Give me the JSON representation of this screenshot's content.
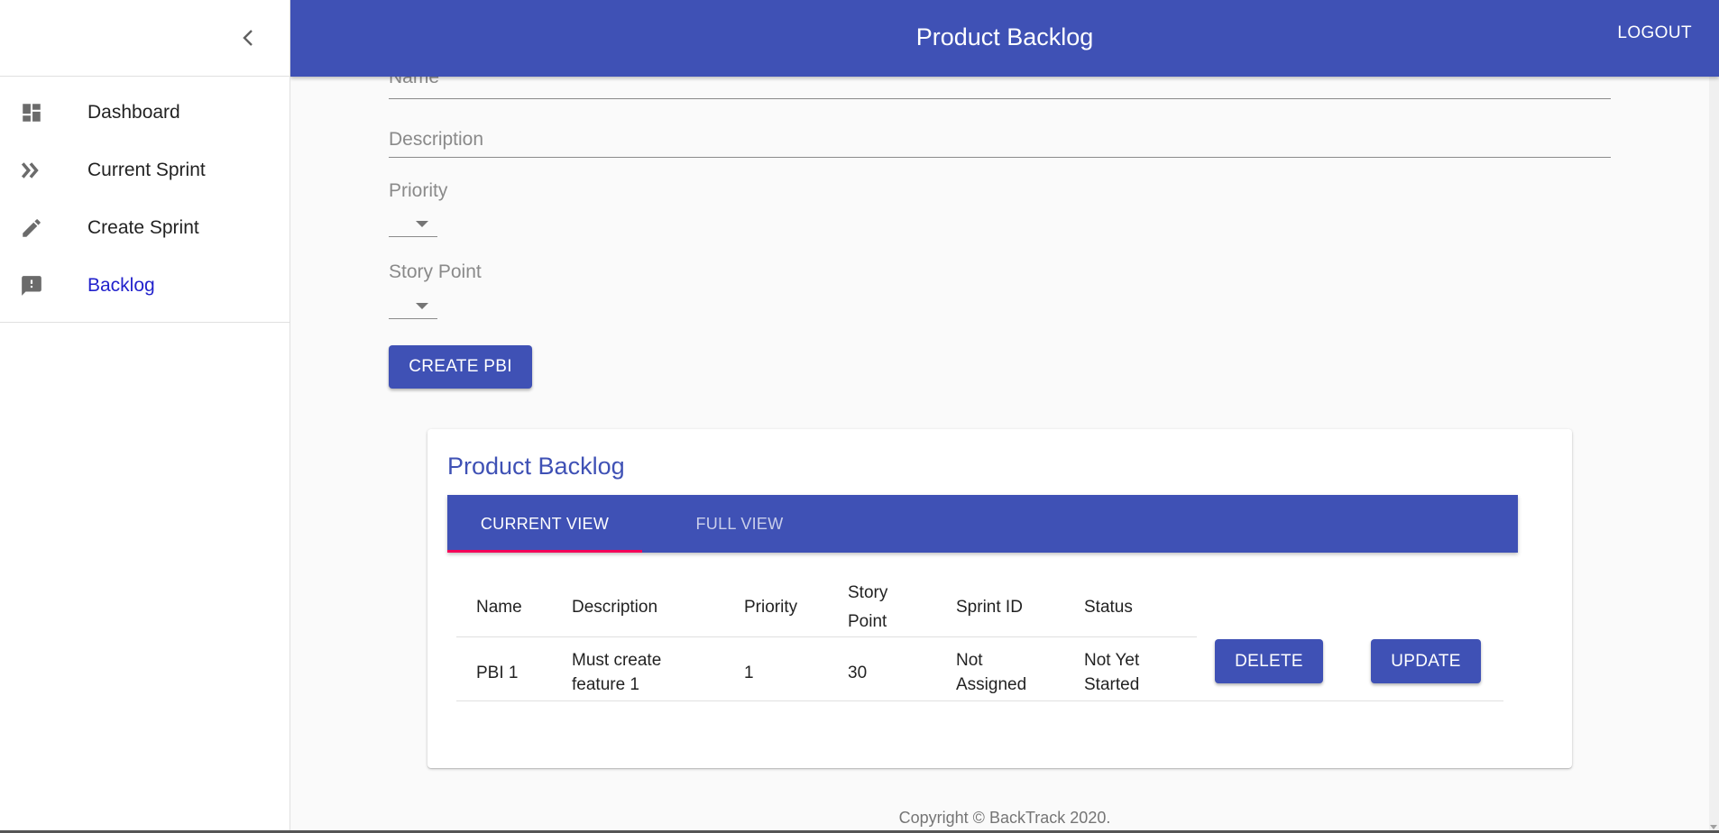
{
  "header": {
    "title": "Product Backlog",
    "logout_label": "LOGOUT"
  },
  "sidebar": {
    "items": [
      {
        "label": "Dashboard",
        "icon": "dashboard-icon"
      },
      {
        "label": "Current Sprint",
        "icon": "double-chevron-right-icon"
      },
      {
        "label": "Create Sprint",
        "icon": "pencil-icon"
      },
      {
        "label": "Backlog",
        "icon": "feedback-icon",
        "active": true
      }
    ]
  },
  "form": {
    "name_placeholder": "Name",
    "description_placeholder": "Description",
    "priority_label": "Priority",
    "story_point_label": "Story Point",
    "create_button": "CREATE PBI"
  },
  "backlog": {
    "title": "Product Backlog",
    "tabs": [
      {
        "label": "CURRENT VIEW",
        "selected": true
      },
      {
        "label": "FULL VIEW",
        "selected": false
      }
    ],
    "columns": {
      "name": "Name",
      "description": "Description",
      "priority": "Priority",
      "story_point_1": "Story",
      "story_point_2": "Point",
      "sprint_id": "Sprint ID",
      "status": "Status"
    },
    "rows": [
      {
        "name": "PBI 1",
        "description_1": "Must create",
        "description_2": "feature 1",
        "priority": "1",
        "story_point": "30",
        "sprint_id_1": "Not",
        "sprint_id_2": "Assigned",
        "status_1": "Not Yet",
        "status_2": "Started",
        "delete_label": "DELETE",
        "update_label": "UPDATE"
      }
    ]
  },
  "footer": {
    "text": "Copyright © BackTrack 2020."
  },
  "colors": {
    "primary": "#3f51b5",
    "tab_indicator": "#f50057",
    "active_nav": "#2222cc"
  }
}
